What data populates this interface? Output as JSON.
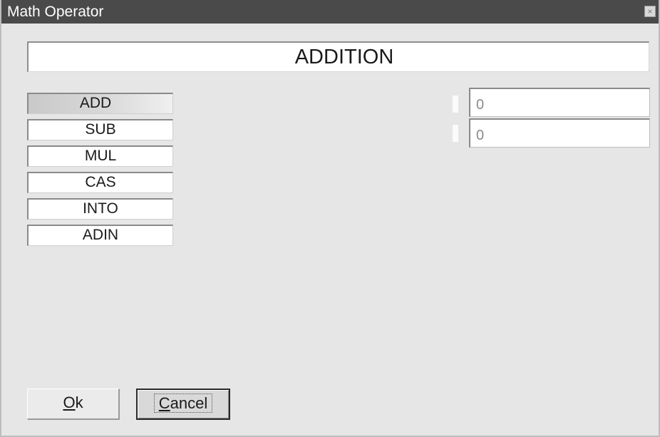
{
  "window": {
    "title": "Math Operator",
    "close_glyph": "×"
  },
  "heading": {
    "text": "ADDITION"
  },
  "operations": {
    "items": [
      {
        "label": "ADD",
        "selected": true
      },
      {
        "label": "SUB",
        "selected": false
      },
      {
        "label": "MUL",
        "selected": false
      },
      {
        "label": "CAS",
        "selected": false
      },
      {
        "label": "INTO",
        "selected": false
      },
      {
        "label": "ADIN",
        "selected": false
      }
    ]
  },
  "operands": {
    "first_value": "0",
    "second_value": "0"
  },
  "buttons": {
    "ok": {
      "mnemonic": "O",
      "rest": "k"
    },
    "cancel": {
      "mnemonic": "C",
      "rest": "ancel"
    }
  },
  "colors": {
    "titlebar": "#4a4a4a",
    "dialog_background": "#e6e6e6",
    "field_background": "#ffffff"
  }
}
